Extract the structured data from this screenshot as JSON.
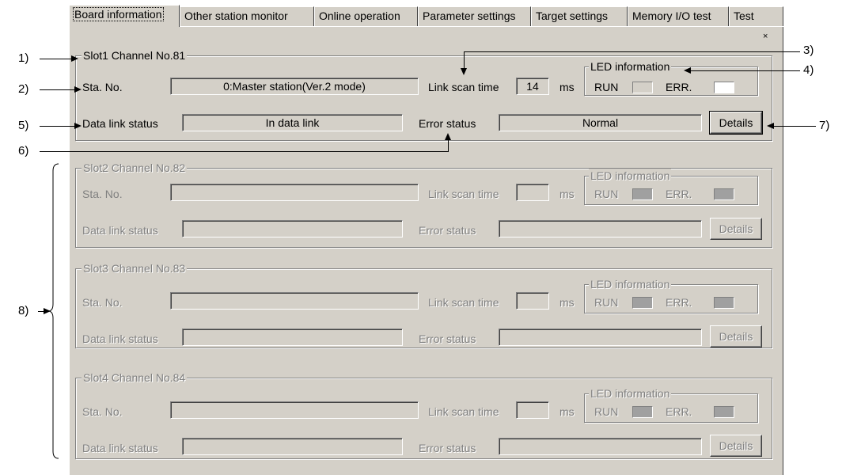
{
  "tabs": [
    {
      "label": "Board information",
      "active": true
    },
    {
      "label": "Other station monitor",
      "active": false
    },
    {
      "label": "Online operation",
      "active": false
    },
    {
      "label": "Parameter settings",
      "active": false
    },
    {
      "label": "Target settings",
      "active": false
    },
    {
      "label": "Memory I/O test",
      "active": false
    },
    {
      "label": "Test",
      "active": false
    }
  ],
  "close_mark": "×",
  "labels": {
    "sta_no": "Sta. No.",
    "link_scan_time": "Link scan time",
    "ms": "ms",
    "led_information": "LED information",
    "run": "RUN",
    "err": "ERR.",
    "data_link_status": "Data link status",
    "error_status": "Error status",
    "details": "Details"
  },
  "slots": [
    {
      "title": "Slot1 Channel No.81",
      "enabled": true,
      "sta_no": "0:Master station(Ver.2 mode)",
      "link_scan_time": "14",
      "data_link_status": "In data link",
      "error_status": "Normal",
      "run_led": "off",
      "err_led": "off"
    },
    {
      "title": "Slot2 Channel No.82",
      "enabled": false,
      "sta_no": "",
      "link_scan_time": "",
      "data_link_status": "",
      "error_status": "",
      "run_led": "gray",
      "err_led": "gray"
    },
    {
      "title": "Slot3 Channel No.83",
      "enabled": false,
      "sta_no": "",
      "link_scan_time": "",
      "data_link_status": "",
      "error_status": "",
      "run_led": "gray",
      "err_led": "gray"
    },
    {
      "title": "Slot4 Channel No.84",
      "enabled": false,
      "sta_no": "",
      "link_scan_time": "",
      "data_link_status": "",
      "error_status": "",
      "run_led": "gray",
      "err_led": "gray"
    }
  ],
  "callouts": [
    "1)",
    "2)",
    "3)",
    "4)",
    "5)",
    "6)",
    "7)",
    "8)"
  ]
}
